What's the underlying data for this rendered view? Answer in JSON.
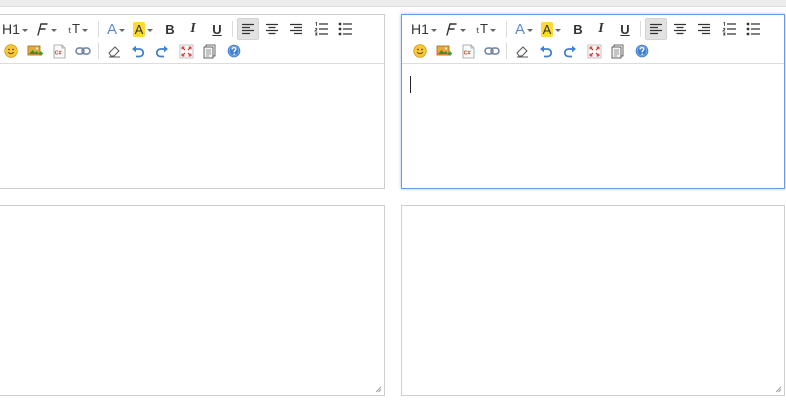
{
  "toolbar": {
    "heading_label": "H1",
    "fontsize_label": "ₜT",
    "forecolor_label": "A",
    "backcolor_label": "A",
    "bold_label": "B",
    "italic_label": "I",
    "underline_label": "U",
    "code_label": "C#"
  },
  "editors": [
    {
      "id": "left",
      "focused": false,
      "has_cursor": false
    },
    {
      "id": "right",
      "focused": true,
      "has_cursor": true
    }
  ],
  "colors": {
    "focus_border": "#6a9be6",
    "border": "#cfcfcf",
    "toolbar_icon": "#333333",
    "forecolor_a": "#5a8ad6",
    "backcolor_highlight": "#ffd83a",
    "link_blue": "#3f7fd4"
  }
}
